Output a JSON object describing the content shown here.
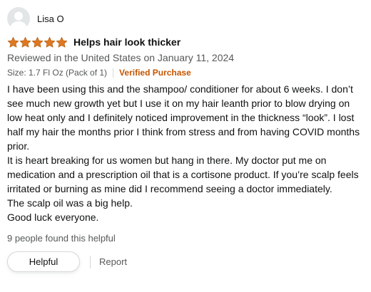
{
  "profile": {
    "name": "Lisa O",
    "avatar_icon": "user-silhouette-icon"
  },
  "review": {
    "rating": 5,
    "rating_max": 5,
    "star_color": "#de7921",
    "star_icon": "star-icon",
    "title": "Helps hair look thicker",
    "date": "Reviewed in the United States on January 11, 2024",
    "format": "Size: 1.7 Fl Oz (Pack of 1)",
    "verified": "Verified Purchase",
    "verified_color": "#c45500",
    "body": [
      "I have been using this and the shampoo/ conditioner for about 6 weeks. I don’t see much new growth yet but I use it on my hair leanth prior to blow drying on low heat only and I definitely noticed improvement in the thickness “look”. I lost half my hair the months prior I think from stress and from having COVID months prior.",
      "It is heart breaking for us women but hang in there. My doctor put me on medication and a prescription oil that is a cortisone product. If you’re scalp feels irritated or burning as mine did I recommend seeing a doctor immediately.",
      "The scalp oil was a big help.",
      "Good luck everyone."
    ],
    "helpful_count": "9 people found this helpful"
  },
  "actions": {
    "helpful_label": "Helpful",
    "report_label": "Report"
  }
}
